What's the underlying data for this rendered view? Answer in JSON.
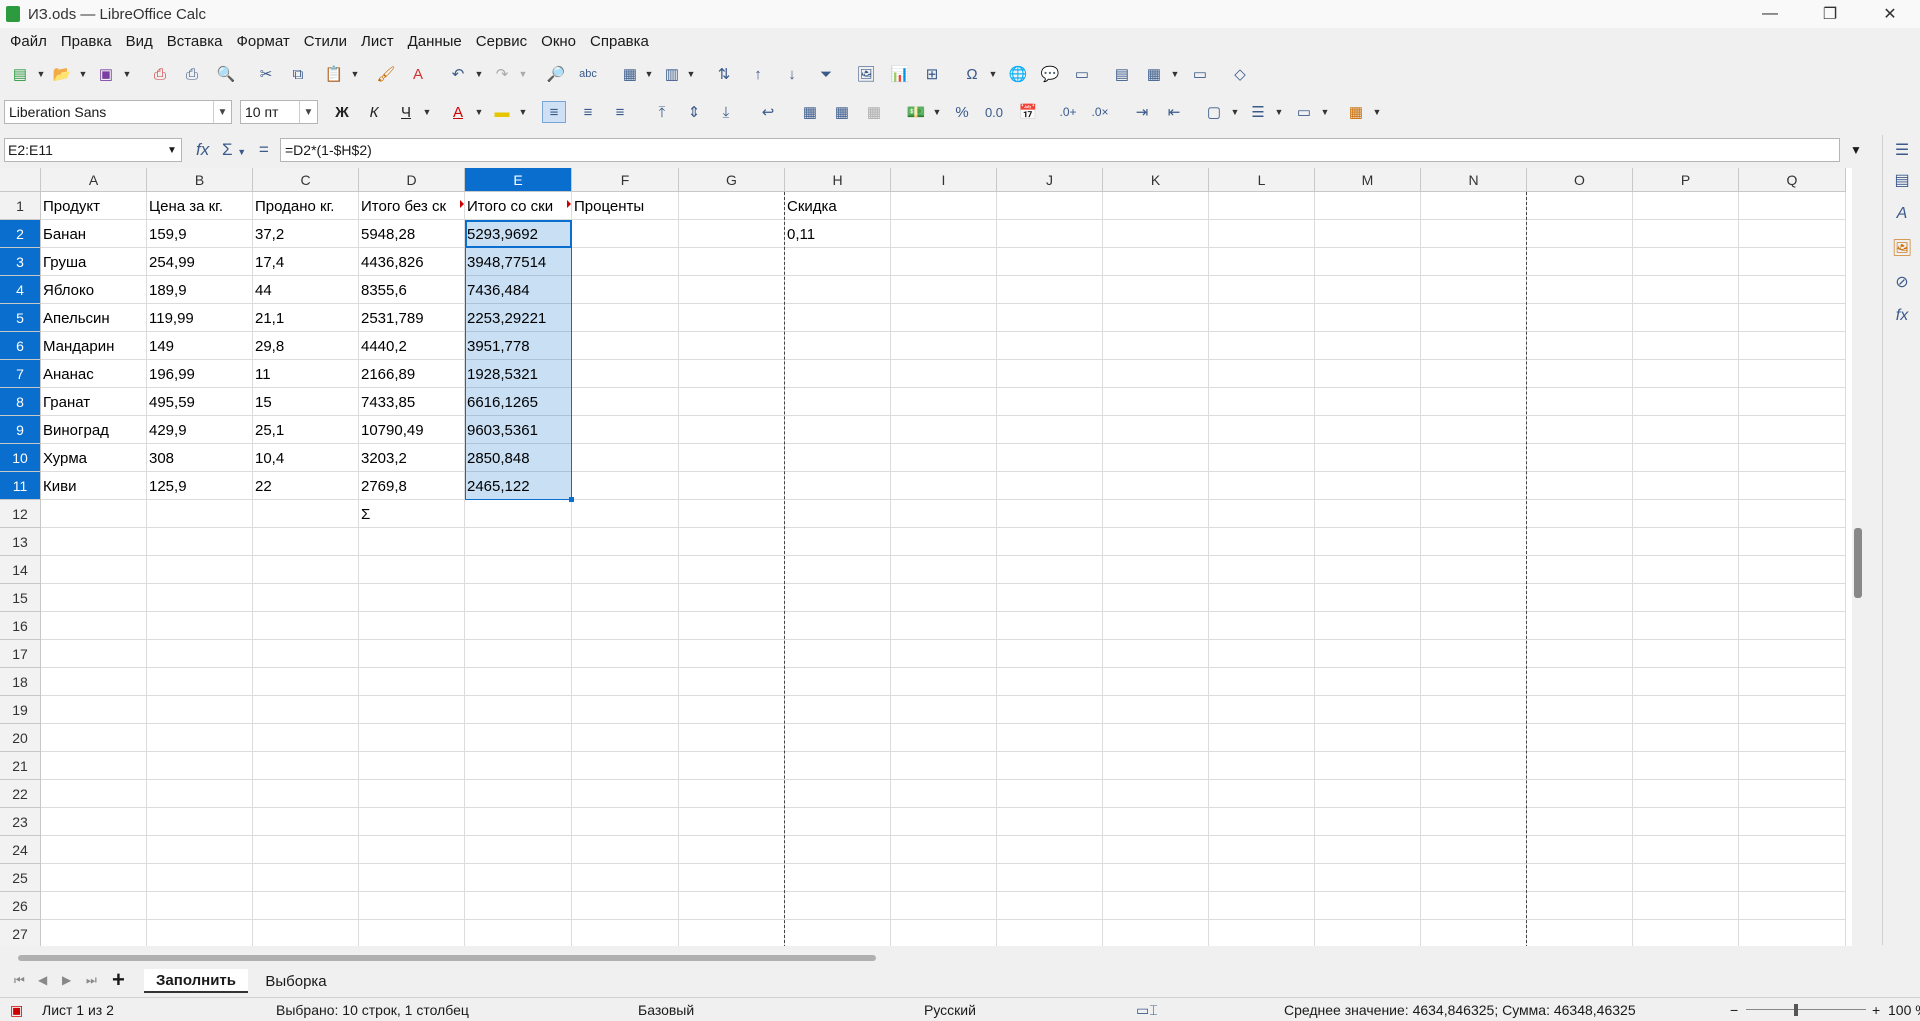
{
  "window": {
    "title": "ИЗ.ods — LibreOffice Calc"
  },
  "menu": [
    "Файл",
    "Правка",
    "Вид",
    "Вставка",
    "Формат",
    "Стили",
    "Лист",
    "Данные",
    "Сервис",
    "Окно",
    "Справка"
  ],
  "format_toolbar": {
    "font_name": "Liberation Sans",
    "font_size": "10 пт",
    "bold": "Ж",
    "italic": "К",
    "underline": "Ч"
  },
  "formula_bar": {
    "name_box": "E2:E11",
    "formula": "=D2*(1-$H$2)"
  },
  "columns": [
    "A",
    "B",
    "C",
    "D",
    "E",
    "F",
    "G",
    "H",
    "I",
    "J",
    "K",
    "L",
    "M",
    "N",
    "O",
    "P",
    "Q"
  ],
  "rows": [
    "1",
    "2",
    "3",
    "4",
    "5",
    "6",
    "7",
    "8",
    "9",
    "10",
    "11",
    "12",
    "13",
    "14",
    "15",
    "16",
    "17",
    "18",
    "19",
    "20",
    "21",
    "22",
    "23",
    "24",
    "25",
    "26",
    "27"
  ],
  "headers": {
    "A": "Продукт",
    "B": "Цена за кг.",
    "C": "Продано кг.",
    "D": "Итого без ск",
    "E": "Итого со ски",
    "F": "Проценты",
    "H": "Скидка"
  },
  "table": [
    [
      "Банан",
      "159,9",
      "37,2",
      "5948,28",
      "5293,9692"
    ],
    [
      "Груша",
      "254,99",
      "17,4",
      "4436,826",
      "3948,77514"
    ],
    [
      "Яблоко",
      "189,9",
      "44",
      "8355,6",
      "7436,484"
    ],
    [
      "Апельсин",
      "119,99",
      "21,1",
      "2531,789",
      "2253,29221"
    ],
    [
      "Мандарин",
      "149",
      "29,8",
      "4440,2",
      "3951,778"
    ],
    [
      "Ананас",
      "196,99",
      "11",
      "2166,89",
      "1928,5321"
    ],
    [
      "Гранат",
      "495,59",
      "15",
      "7433,85",
      "6616,1265"
    ],
    [
      "Виноград",
      "429,9",
      "25,1",
      "10790,49",
      "9603,5361"
    ],
    [
      "Хурма",
      "308",
      "10,4",
      "3203,2",
      "2850,848"
    ],
    [
      "Киви",
      "125,9",
      "22",
      "2769,8",
      "2465,122"
    ]
  ],
  "discount_value": "0,11",
  "sum_symbol": "Σ",
  "sheet_tabs": [
    "Заполнить",
    "Выборка"
  ],
  "status": {
    "sheet": "Лист 1 из 2",
    "selection": "Выбрано: 10 строк, 1 столбец",
    "style": "Базовый",
    "language": "Русский",
    "summary": "Среднее значение: 4634,846325; Сумма: 46348,46325",
    "zoom": "100 %"
  }
}
